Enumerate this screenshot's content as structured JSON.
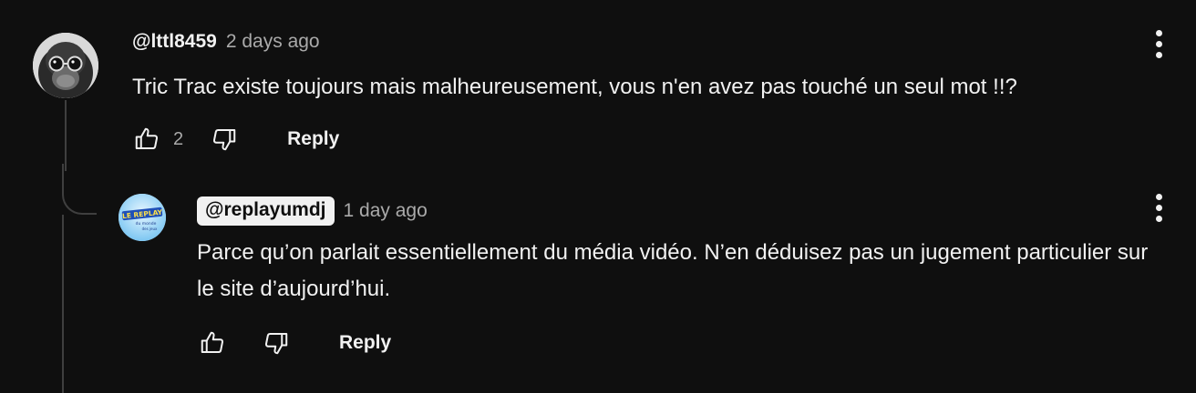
{
  "colors": {
    "background": "#0f0f0f",
    "text": "#f1f1f1",
    "secondary_text": "#aaaaaa",
    "thread_line": "#3f3f3f",
    "handle_chip": "#f1f1f1"
  },
  "comment": {
    "author": "@lttl8459",
    "time": "2 days ago",
    "text": "Tric Trac existe toujours mais malheureusement, vous n'en avez pas touché un seul mot !!?",
    "like_count": "2",
    "reply_label": "Reply",
    "avatar_icon": "monkey-with-glasses-avatar"
  },
  "reply": {
    "author": "@replayumdj",
    "time": "1 day ago",
    "text": "Parce qu’on parlait essentiellement du média vidéo. N’en déduisez pas un jugement particulier sur le site d’aujourd’hui.",
    "reply_label": "Reply",
    "avatar_logo": {
      "line1": "LE REPLAY",
      "line2": "du monde",
      "line3": "des jeux"
    }
  }
}
